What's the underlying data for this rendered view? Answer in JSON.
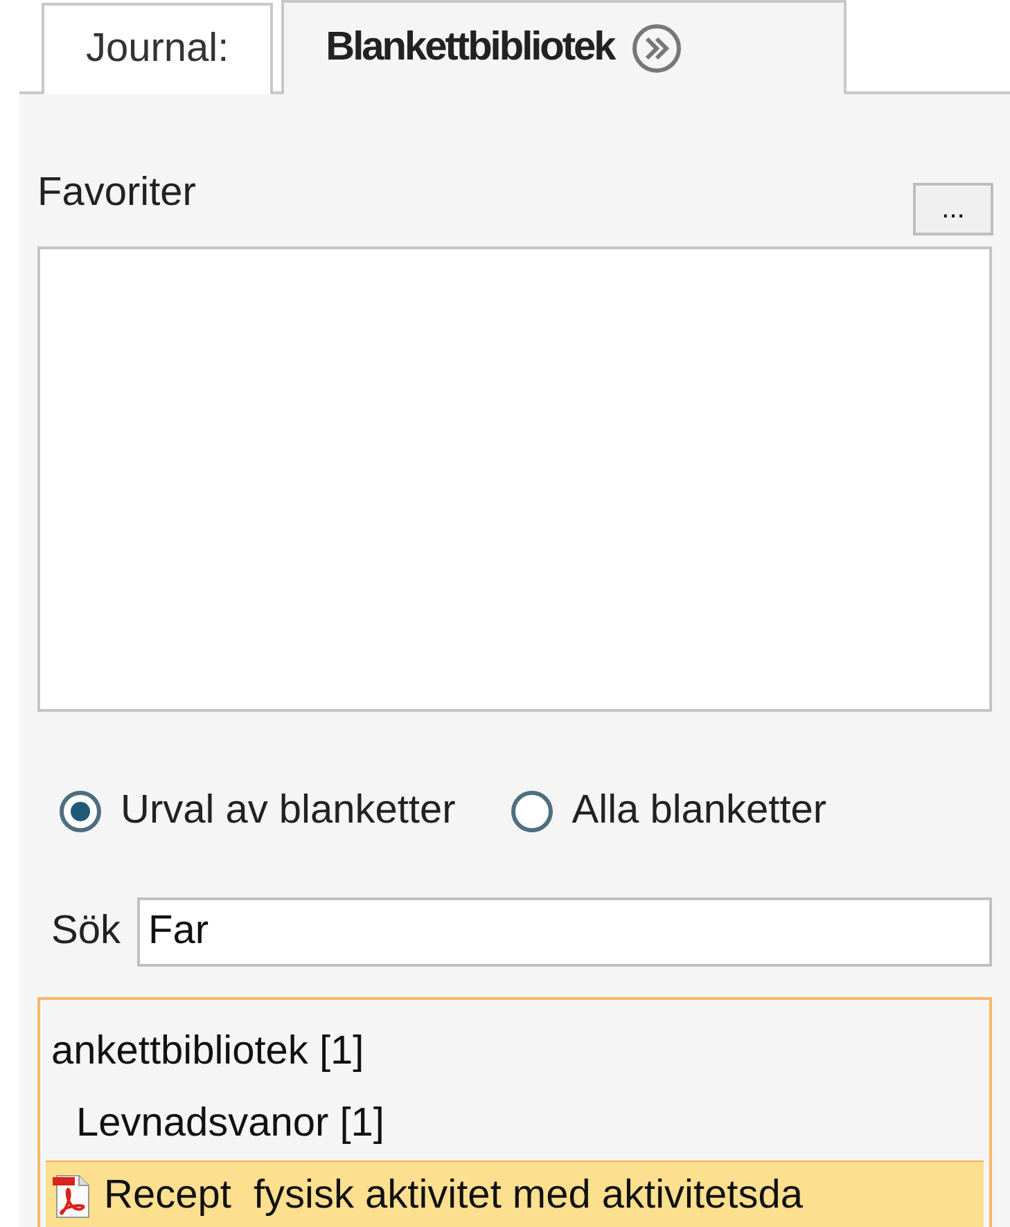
{
  "tabs": [
    {
      "label": "Journal:",
      "selected": false
    },
    {
      "label": "Blankettbibliotek",
      "selected": true
    }
  ],
  "favorites": {
    "label": "Favoriter",
    "more_button": "..."
  },
  "scope_options": [
    {
      "label": "Urval av blanketter",
      "selected": true
    },
    {
      "label": "Alla blanketter",
      "selected": false
    }
  ],
  "search": {
    "label": "Sök",
    "value": "Far"
  },
  "tree": [
    {
      "label": "ankettbibliotek [1]",
      "kind": "folder",
      "selected": false,
      "children": [
        {
          "label": "Levnadsvanor [1]",
          "kind": "folder",
          "selected": false,
          "children": [
            {
              "label": "Recept  fysisk aktivitet med aktivitetsda",
              "kind": "pdf",
              "selected": true
            }
          ]
        }
      ]
    }
  ]
}
